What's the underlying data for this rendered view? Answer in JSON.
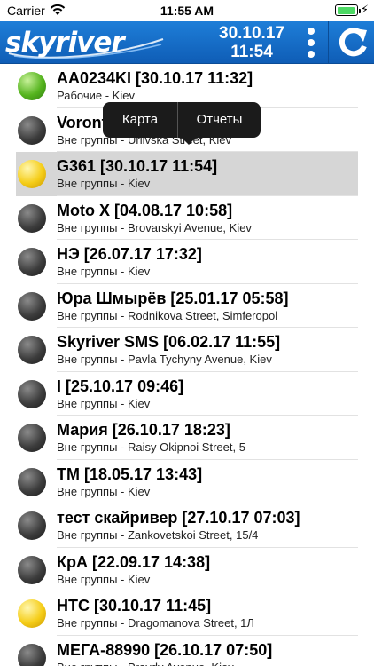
{
  "status_bar": {
    "carrier": "Carrier",
    "time": "11:55 AM"
  },
  "header": {
    "logo": "skyriver",
    "date": "30.10.17",
    "time": "11:54",
    "colors": {
      "header_bg": "#1673d0",
      "text": "#ffffff"
    }
  },
  "popup": {
    "map": "Карта",
    "reports": "Отчеты"
  },
  "vehicles": [
    {
      "title": "AA0234KI [30.10.17 11:32]",
      "subtitle": "Рабочие - Kiev",
      "status": "green"
    },
    {
      "title": "Voront",
      "subtitle": "Вне группы - Urlivska Street, Kiev",
      "status": "dark"
    },
    {
      "title": "G361 [30.10.17 11:54]",
      "subtitle": "Вне группы - Kiev",
      "status": "yellow",
      "selected": true
    },
    {
      "title": "Moto X [04.08.17 10:58]",
      "subtitle": "Вне группы - Brovarskyi Avenue, Kiev",
      "status": "dark"
    },
    {
      "title": "НЭ [26.07.17 17:32]",
      "subtitle": "Вне группы - Kiev",
      "status": "dark"
    },
    {
      "title": "Юра Шмырёв [25.01.17 05:58]",
      "subtitle": "Вне группы - Rodnikova Street, Simferopol",
      "status": "dark"
    },
    {
      "title": "Skyriver SMS [06.02.17 11:55]",
      "subtitle": "Вне группы - Pavla Tychyny Avenue, Kiev",
      "status": "dark"
    },
    {
      "title": "I [25.10.17 09:46]",
      "subtitle": "Вне группы - Kiev",
      "status": "dark"
    },
    {
      "title": "Мария [26.10.17 18:23]",
      "subtitle": "Вне группы - Raisy Okipnoi Street, 5",
      "status": "dark"
    },
    {
      "title": "TM [18.05.17 13:43]",
      "subtitle": "Вне группы - Kiev",
      "status": "dark"
    },
    {
      "title": "тест скайривер [27.10.17 07:03]",
      "subtitle": "Вне группы - Zankovetskoi Street, 15/4",
      "status": "dark"
    },
    {
      "title": "КрА [22.09.17 14:38]",
      "subtitle": "Вне группы - Kiev",
      "status": "dark"
    },
    {
      "title": "HTC [30.10.17 11:45]",
      "subtitle": "Вне группы - Dragomanova Street, 1Л",
      "status": "yellow"
    },
    {
      "title": "МЕГА-88990 [26.10.17 07:50]",
      "subtitle": "Вне группы - Pravdy Avenue, Kiev",
      "status": "dark"
    }
  ]
}
